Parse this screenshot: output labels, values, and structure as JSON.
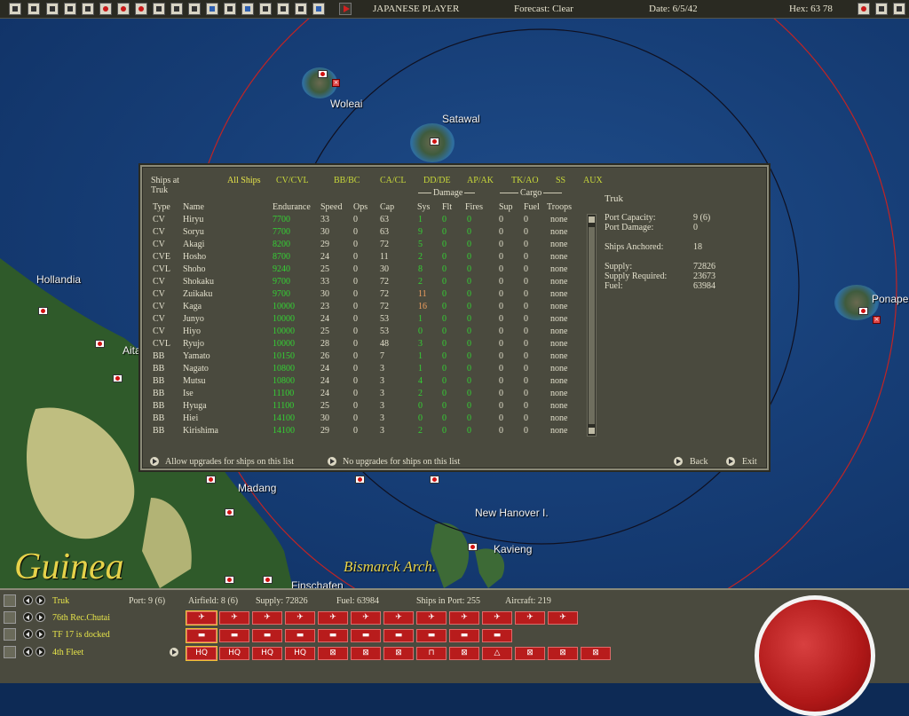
{
  "topbar": {
    "player": "JAPANESE PLAYER",
    "forecast": "Forecast: Clear",
    "date": "Date: 6/5/42",
    "hex": "Hex: 63 78"
  },
  "map": {
    "places": {
      "woleai": "Woleai",
      "satawal": "Satawal",
      "hollandia": "Hollandia",
      "aitape": "Aita",
      "ponape": "Ponape",
      "madang": "Madang",
      "new_hanover": "New Hanover I.",
      "kavieng": "Kavieng",
      "bismarck": "Bismarck Arch.",
      "finschafen": "Finschafen",
      "guinea": "Guinea"
    }
  },
  "dialog": {
    "title_line1": "Ships at",
    "title_line2": "Truk",
    "filters": [
      "All Ships",
      "CV/CVL",
      "BB/BC",
      "CA/CL",
      "DD/DE",
      "AP/AK",
      "TK/AO",
      "SS",
      "AUX"
    ],
    "group_damage": "Damage",
    "group_cargo": "Cargo",
    "columns": {
      "type": "Type",
      "name": "Name",
      "endurance": "Endurance",
      "speed": "Speed",
      "ops": "Ops",
      "cap": "Cap",
      "sys": "Sys",
      "flt": "Flt",
      "fires": "Fires",
      "sup": "Sup",
      "fuel": "Fuel",
      "troops": "Troops"
    },
    "ships": [
      {
        "type": "CV",
        "name": "Hiryu",
        "endurance": "7700",
        "speed": "33",
        "ops": "0",
        "cap": "63",
        "sys": "1",
        "flt": "0",
        "fires": "0",
        "sup": "0",
        "fuel": "0",
        "troops": "none"
      },
      {
        "type": "CV",
        "name": "Soryu",
        "endurance": "7700",
        "speed": "30",
        "ops": "0",
        "cap": "63",
        "sys": "9",
        "flt": "0",
        "fires": "0",
        "sup": "0",
        "fuel": "0",
        "troops": "none"
      },
      {
        "type": "CV",
        "name": "Akagi",
        "endurance": "8200",
        "speed": "29",
        "ops": "0",
        "cap": "72",
        "sys": "5",
        "flt": "0",
        "fires": "0",
        "sup": "0",
        "fuel": "0",
        "troops": "none"
      },
      {
        "type": "CVE",
        "name": "Hosho",
        "endurance": "8700",
        "speed": "24",
        "ops": "0",
        "cap": "11",
        "sys": "2",
        "flt": "0",
        "fires": "0",
        "sup": "0",
        "fuel": "0",
        "troops": "none"
      },
      {
        "type": "CVL",
        "name": "Shoho",
        "endurance": "9240",
        "speed": "25",
        "ops": "0",
        "cap": "30",
        "sys": "8",
        "flt": "0",
        "fires": "0",
        "sup": "0",
        "fuel": "0",
        "troops": "none"
      },
      {
        "type": "CV",
        "name": "Shokaku",
        "endurance": "9700",
        "speed": "33",
        "ops": "0",
        "cap": "72",
        "sys": "2",
        "flt": "0",
        "fires": "0",
        "sup": "0",
        "fuel": "0",
        "troops": "none"
      },
      {
        "type": "CV",
        "name": "Zuikaku",
        "endurance": "9700",
        "speed": "30",
        "ops": "0",
        "cap": "72",
        "sys": "11",
        "flt": "0",
        "fires": "0",
        "sup": "0",
        "fuel": "0",
        "troops": "none"
      },
      {
        "type": "CV",
        "name": "Kaga",
        "endurance": "10000",
        "speed": "23",
        "ops": "0",
        "cap": "72",
        "sys": "16",
        "flt": "0",
        "fires": "0",
        "sup": "0",
        "fuel": "0",
        "troops": "none"
      },
      {
        "type": "CV",
        "name": "Junyo",
        "endurance": "10000",
        "speed": "24",
        "ops": "0",
        "cap": "53",
        "sys": "1",
        "flt": "0",
        "fires": "0",
        "sup": "0",
        "fuel": "0",
        "troops": "none"
      },
      {
        "type": "CV",
        "name": "Hiyo",
        "endurance": "10000",
        "speed": "25",
        "ops": "0",
        "cap": "53",
        "sys": "0",
        "flt": "0",
        "fires": "0",
        "sup": "0",
        "fuel": "0",
        "troops": "none"
      },
      {
        "type": "CVL",
        "name": "Ryujo",
        "endurance": "10000",
        "speed": "28",
        "ops": "0",
        "cap": "48",
        "sys": "3",
        "flt": "0",
        "fires": "0",
        "sup": "0",
        "fuel": "0",
        "troops": "none"
      },
      {
        "type": "BB",
        "name": "Yamato",
        "endurance": "10150",
        "speed": "26",
        "ops": "0",
        "cap": "7",
        "sys": "1",
        "flt": "0",
        "fires": "0",
        "sup": "0",
        "fuel": "0",
        "troops": "none"
      },
      {
        "type": "BB",
        "name": "Nagato",
        "endurance": "10800",
        "speed": "24",
        "ops": "0",
        "cap": "3",
        "sys": "1",
        "flt": "0",
        "fires": "0",
        "sup": "0",
        "fuel": "0",
        "troops": "none"
      },
      {
        "type": "BB",
        "name": "Mutsu",
        "endurance": "10800",
        "speed": "24",
        "ops": "0",
        "cap": "3",
        "sys": "4",
        "flt": "0",
        "fires": "0",
        "sup": "0",
        "fuel": "0",
        "troops": "none"
      },
      {
        "type": "BB",
        "name": "Ise",
        "endurance": "11100",
        "speed": "24",
        "ops": "0",
        "cap": "3",
        "sys": "2",
        "flt": "0",
        "fires": "0",
        "sup": "0",
        "fuel": "0",
        "troops": "none"
      },
      {
        "type": "BB",
        "name": "Hyuga",
        "endurance": "11100",
        "speed": "25",
        "ops": "0",
        "cap": "3",
        "sys": "0",
        "flt": "0",
        "fires": "0",
        "sup": "0",
        "fuel": "0",
        "troops": "none"
      },
      {
        "type": "BB",
        "name": "Hiei",
        "endurance": "14100",
        "speed": "30",
        "ops": "0",
        "cap": "3",
        "sys": "0",
        "flt": "0",
        "fires": "0",
        "sup": "0",
        "fuel": "0",
        "troops": "none"
      },
      {
        "type": "BB",
        "name": "Kirishima",
        "endurance": "14100",
        "speed": "29",
        "ops": "0",
        "cap": "3",
        "sys": "2",
        "flt": "0",
        "fires": "0",
        "sup": "0",
        "fuel": "0",
        "troops": "none"
      }
    ],
    "info": {
      "base": "Truk",
      "port_capacity_label": "Port Capacity:",
      "port_capacity": "9 (6)",
      "port_damage_label": "Port Damage:",
      "port_damage": "0",
      "ships_anchored_label": "Ships Anchored:",
      "ships_anchored": "18",
      "supply_label": "Supply:",
      "supply": "72826",
      "supply_required_label": "Supply Required:",
      "supply_required": "23673",
      "fuel_label": "Fuel:",
      "fuel": "63984"
    },
    "actions": {
      "allow_upgrades": "Allow upgrades for ships on this list",
      "no_upgrades": "No upgrades for ships on this list",
      "back": "Back",
      "exit": "Exit"
    }
  },
  "bottom": {
    "base": "Truk",
    "air_unit": "76th Rec.Chutai",
    "task_force": "TF 17 is docked",
    "fleet": "4th Fleet",
    "port": "Port: 9 (6)",
    "airfield": "Airfield: 8 (6)",
    "supply": "Supply: 72826",
    "fuel": "Fuel: 63984",
    "ships_in_port": "Ships in Port: 255",
    "aircraft": "Aircraft: 219",
    "hq_label": "HQ",
    "colors": {
      "unit_red": "#b81c1c",
      "text_yellow": "#e6e44a",
      "value_green": "#34d234",
      "damage_orange": "#f0a060"
    }
  }
}
